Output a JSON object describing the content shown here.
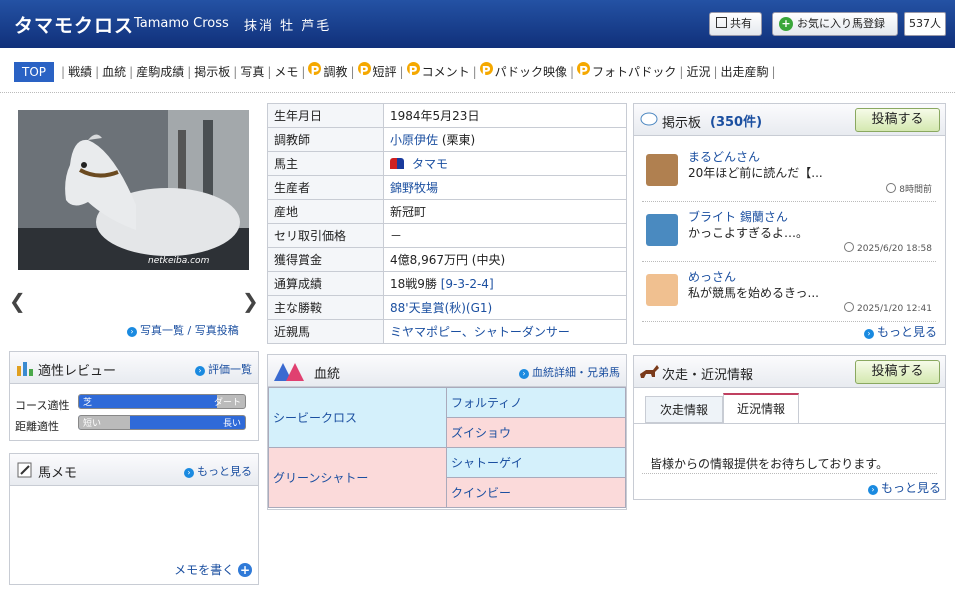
{
  "header": {
    "title": "タマモクロス",
    "title_en": "Tamamo Cross",
    "status": "抹消 牡 芦毛",
    "share_label": "共有",
    "favorite_label": "お気に入り馬登録",
    "favorite_count": "537人"
  },
  "nav": {
    "items": [
      "TOP",
      "戦績",
      "血統",
      "産駒成績",
      "掲示板",
      "写真",
      "メモ",
      "調教",
      "短評",
      "コメント",
      "パドック映像",
      "フォトパドック",
      "近況",
      "出走産駒"
    ]
  },
  "photo": {
    "watermark": "netkeiba.com",
    "links": "写真一覧 / 写真投稿"
  },
  "profile": [
    {
      "k": "生年月日",
      "v": "1984年5月23日"
    },
    {
      "k": "調教師",
      "v": "小原伊佐",
      "v2": " (栗東)"
    },
    {
      "k": "馬主",
      "v": "タマモ"
    },
    {
      "k": "生産者",
      "v": "錦野牧場"
    },
    {
      "k": "産地",
      "v": "新冠町"
    },
    {
      "k": "セリ取引価格",
      "v": "－"
    },
    {
      "k": "獲得賞金",
      "v": "4億8,967万円 (中央)"
    },
    {
      "k": "通算成績",
      "v": "18戦9勝 ",
      "v2": "[9-3-2-4]"
    },
    {
      "k": "主な勝鞍",
      "v": "88'天皇賞(秋)(G1)"
    },
    {
      "k": "近親馬",
      "v": "ミヤマポピー、シャトーダンサー"
    }
  ],
  "aptitude": {
    "title": "適性レビュー",
    "link": "評価一覧",
    "course": {
      "label": "コース適性",
      "left": "芝",
      "right": "ダート",
      "level": 0.83
    },
    "distance": {
      "label": "距離適性",
      "left": "短い",
      "right": "長い",
      "level": 0.31
    }
  },
  "memo": {
    "title": "馬メモ",
    "more": "もっと見る",
    "write": "メモを書く"
  },
  "pedigree": {
    "title": "血統",
    "link": "血統詳細・兄弟馬",
    "sire": "シービークロス",
    "dam": "グリーンシャトー",
    "ss": "フォルティノ",
    "sd": "ズイショウ",
    "ds": "シャトーゲイ",
    "dd": "クインビー"
  },
  "board": {
    "title": "掲示板",
    "count": "(350件)",
    "post": "投稿する",
    "more": "もっと見る",
    "messages": [
      {
        "name": "まるどんさん",
        "text": "20年ほど前に読んだ【...",
        "time": "8時間前"
      },
      {
        "name": "ブライト 錫蘭さん",
        "text": "かっこよすぎるよ…。",
        "time": "2025/6/20 18:58"
      },
      {
        "name": "めっさん",
        "text": "私が競馬を始めるきっ...",
        "time": "2025/1/20 12:41"
      }
    ]
  },
  "news": {
    "title": "次走・近況情報",
    "post": "投稿する",
    "tab1": "次走情報",
    "tab2": "近況情報",
    "msg": "皆様からの情報提供をお待ちしております。",
    "more": "もっと見る"
  }
}
